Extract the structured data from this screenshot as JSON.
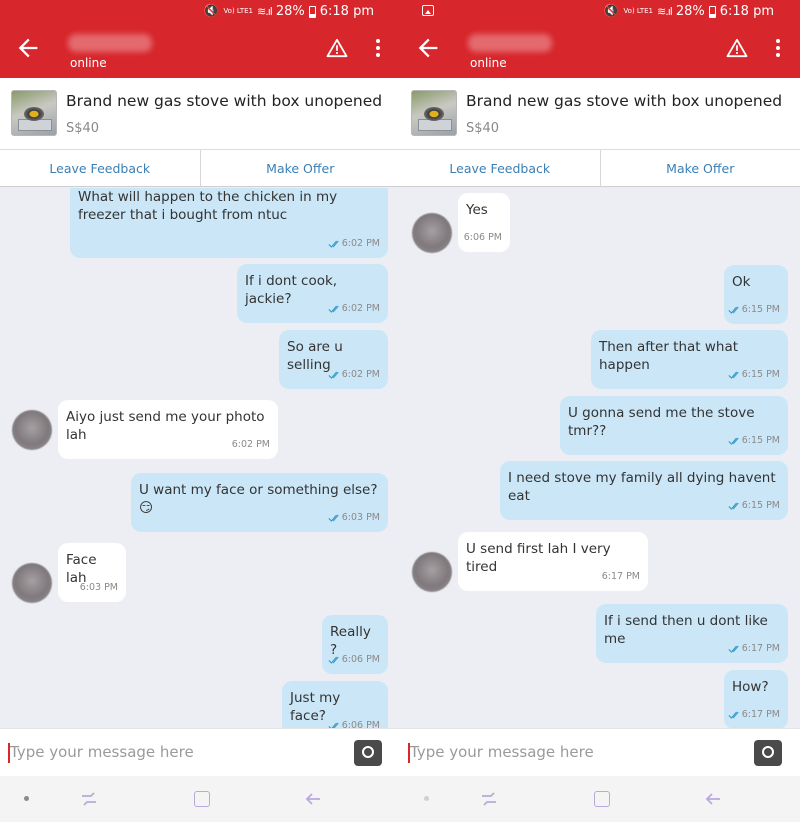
{
  "status_bar": {
    "battery": "28%",
    "time": "6:18 pm",
    "network_label": "Vo) LTE1"
  },
  "header": {
    "status": "online"
  },
  "listing": {
    "title": "Brand new gas stove with box unopened",
    "price": "S$40"
  },
  "actions": {
    "leave_feedback": "Leave Feedback",
    "make_offer": "Make Offer"
  },
  "input": {
    "placeholder": "Type your message here"
  },
  "left_chat": [
    {
      "dir": "out",
      "text": "What will happen to the chicken in my freezer that i bought from ntuc",
      "time": "6:02 PM"
    },
    {
      "dir": "out",
      "text": "If i dont cook, jackie?",
      "time": "6:02 PM"
    },
    {
      "dir": "out",
      "text": "So are u selling",
      "time": "6:02 PM"
    },
    {
      "dir": "in",
      "text": "Aiyo just send me your photo lah",
      "time": "6:02 PM"
    },
    {
      "dir": "out",
      "text": "U want my face or something else? 😏",
      "time": "6:03 PM"
    },
    {
      "dir": "in",
      "text": "Face lah",
      "time": "6:03 PM"
    },
    {
      "dir": "out",
      "text": "Really ?",
      "time": "6:06 PM"
    },
    {
      "dir": "out",
      "text": "Just my face?",
      "time": "6:06 PM"
    }
  ],
  "right_chat": [
    {
      "dir": "in",
      "text": "Yes",
      "time": "6:06 PM"
    },
    {
      "dir": "out",
      "text": "Ok",
      "time": "6:15 PM"
    },
    {
      "dir": "out",
      "text": "Then after that what happen",
      "time": "6:15 PM"
    },
    {
      "dir": "out",
      "text": "U gonna send me the stove tmr??",
      "time": "6:15 PM"
    },
    {
      "dir": "out",
      "text": "I need stove my family all dying havent eat",
      "time": "6:15 PM"
    },
    {
      "dir": "in",
      "text": "U send first lah I very tired",
      "time": "6:17 PM"
    },
    {
      "dir": "out",
      "text": "If i send then u dont like me",
      "time": "6:17 PM"
    },
    {
      "dir": "out",
      "text": "How?",
      "time": "6:17 PM"
    }
  ]
}
